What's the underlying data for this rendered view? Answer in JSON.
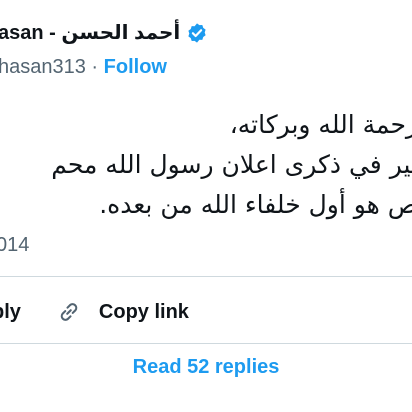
{
  "tweet": {
    "author_name": "asan - أحمد الحسن",
    "verified_icon": "verified-badge-icon",
    "handle": "hasan313",
    "separator": " · ",
    "follow_label": "Follow",
    "text_lines": [
      "رحمة الله وبركاته،",
      "تير في ذكرى اعلان رسول الله محم",
      "ص هو أول خلفاء الله من بعده."
    ],
    "date": "014"
  },
  "actions": {
    "reply_label": "ply",
    "copy_link_label": "Copy link",
    "copy_link_icon": "link-icon"
  },
  "footer": {
    "read_replies_label": "Read 52 replies"
  },
  "colors": {
    "accent": "#1d9bf0",
    "secondary_text": "#536471",
    "divider": "#cfd9de"
  }
}
